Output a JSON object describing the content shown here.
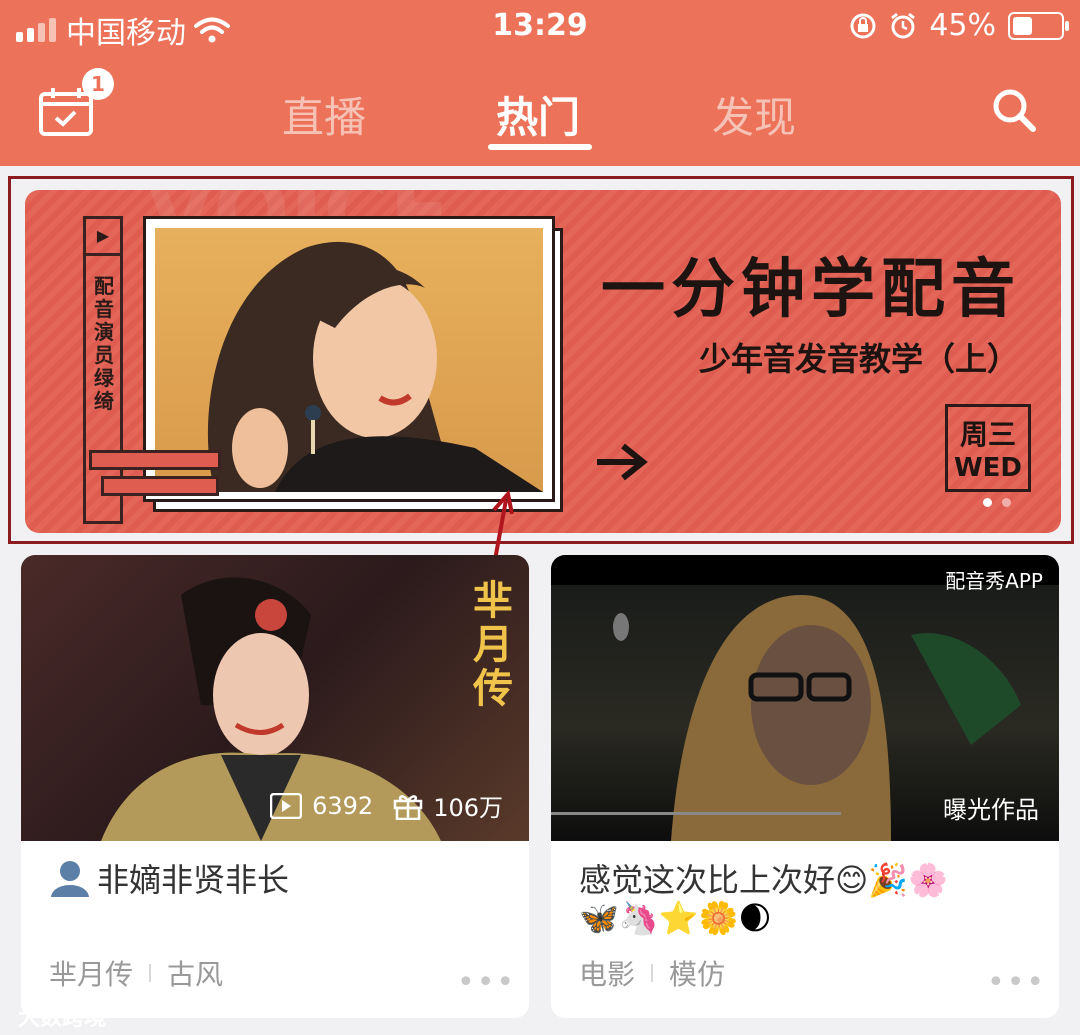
{
  "status": {
    "carrier": "中国移动",
    "time": "13:29",
    "battery": "45%",
    "battery_level": 0.45
  },
  "nav": {
    "badge": "1",
    "tabs": [
      {
        "label": "直播"
      },
      {
        "label": "热门",
        "active": true
      },
      {
        "label": "发现"
      }
    ]
  },
  "banner": {
    "side_text": "配音演员 绿绮",
    "title": "一分钟学配音",
    "subtitle": "少年音发音教学（上）",
    "day_cn": "周三",
    "day_en": "WED",
    "slide_index": 1,
    "slide_count": 2
  },
  "cards": [
    {
      "overlay_text": "芈月传",
      "play_count": "6392",
      "gift_count": "106万",
      "title": "非嫡非贤非长",
      "tags": [
        "芈月传",
        "古风"
      ],
      "more": "•••"
    },
    {
      "watermark": "配音秀APP",
      "badge": "曝光作品",
      "title": "感觉这次比上次好😊🎉🌸",
      "title_line2": "🦋🦄⭐🌼🌒",
      "tags": [
        "电影",
        "模仿"
      ],
      "more": "•••"
    }
  ],
  "page_watermark": "大数跨境"
}
